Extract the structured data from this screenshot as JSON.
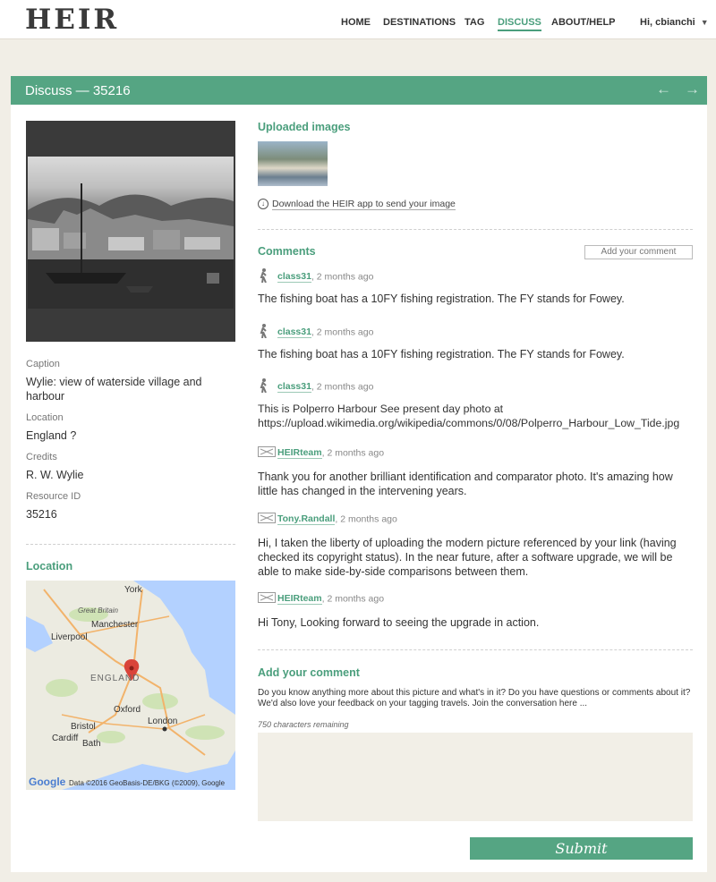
{
  "header": {
    "logo": "HEIR",
    "nav": [
      "HOME",
      "DESTINATIONS",
      "TAG",
      "DISCUSS",
      "ABOUT/HELP"
    ],
    "active_nav": "DISCUSS",
    "user": "Hi, cbianchi"
  },
  "panel": {
    "title": "Discuss — 35216"
  },
  "details": {
    "caption_label": "Caption",
    "caption": "Wylie: view of waterside village and harbour",
    "location_label": "Location",
    "location": "England ?",
    "credits_label": "Credits",
    "credits": "R. W. Wylie",
    "resource_label": "Resource ID",
    "resource_id": "35216"
  },
  "location_section": {
    "title": "Location",
    "map_labels": [
      "York",
      "Great Britain",
      "Manchester",
      "Liverpool",
      "ENGLAND",
      "Oxford",
      "London",
      "Bristol",
      "Cardiff",
      "Bath"
    ],
    "map_attribution": "Data ©2016 GeoBasis-DE/BKG (©2009), Google",
    "map_logo": "Google"
  },
  "uploads": {
    "title": "Uploaded images",
    "download_text": "Download the HEIR app to send your image"
  },
  "comments_section": {
    "title": "Comments",
    "add_button": "Add your comment",
    "items": [
      {
        "author": "class31",
        "time": ", 2 months ago",
        "text": "The fishing boat has a 10FY fishing registration. The FY stands for Fowey.",
        "icon": "hiker-icon"
      },
      {
        "author": "class31",
        "time": ", 2 months ago",
        "text": "The fishing boat has a 10FY fishing registration. The FY stands for Fowey.",
        "icon": "hiker-icon"
      },
      {
        "author": "class31",
        "time": ", 2 months ago",
        "text": "This is Polperro Harbour See present day photo at https://upload.wikimedia.org/wikipedia/commons/0/08/Polperro_Harbour_Low_Tide.jpg",
        "icon": "hiker-icon"
      },
      {
        "author": "HEIRteam",
        "time": ", 2 months ago",
        "text": "Thank you for another brilliant identification and comparator photo. It's amazing how little has changed in the intervening years.",
        "icon": "team-icon"
      },
      {
        "author": "Tony.Randall",
        "time": ", 2 months ago",
        "text": "Hi, I taken the liberty of uploading the modern picture referenced by your link (having checked its copyright status). In the near future, after a software upgrade, we will be able to make side-by-side comparisons between them.",
        "icon": "team-icon"
      },
      {
        "author": "HEIRteam",
        "time": ", 2 months ago",
        "text": "Hi Tony, Looking forward to seeing the upgrade in action.",
        "icon": "team-icon"
      }
    ]
  },
  "add_comment": {
    "title": "Add your comment",
    "intro": "Do you know anything more about this picture and what's in it? Do you have questions or comments about it? We'd also love your feedback on your tagging travels. Join the conversation here ...",
    "remaining": "750 characters remaining",
    "submit": "Submit"
  },
  "colors": {
    "accent": "#55a583",
    "link": "#4a9e7c",
    "background": "#f1eee6"
  }
}
